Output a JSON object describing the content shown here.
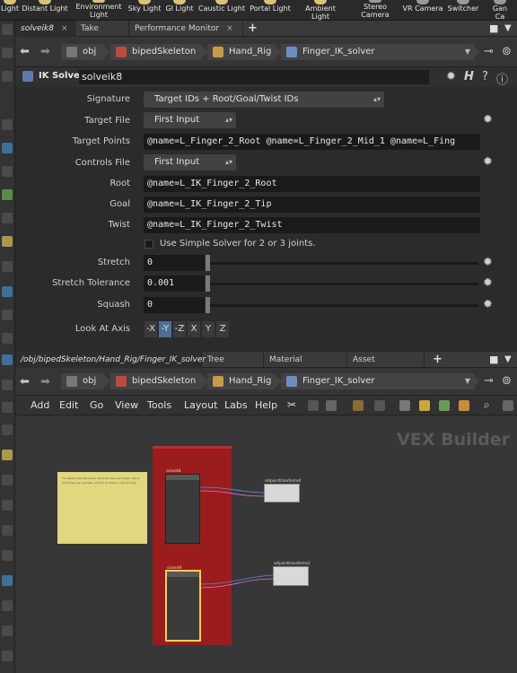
{
  "shelf_tools": [
    "Light",
    "Distant Light",
    "Environment Light",
    "Sky Light",
    "GI Light",
    "Caustic Light",
    "Portal Light",
    "Ambient Light",
    "Stereo Camera",
    "VR Camera",
    "Switcher",
    "Gan Ca"
  ],
  "top_tabs": {
    "active": "solveik8",
    "others": [
      "Take List",
      "Performance Monitor"
    ]
  },
  "path_top": {
    "back": "←",
    "forward": "→",
    "segments": [
      "obj",
      "bipedSkeleton",
      "Hand_Rig",
      "Finger_IK_solver"
    ]
  },
  "param_header": {
    "type_label": "IK Solver",
    "node_name": "solveik8"
  },
  "params": {
    "signature": {
      "label": "Signature",
      "value": "Target IDs + Root/Goal/Twist IDs"
    },
    "target_file": {
      "label": "Target File",
      "value": "First Input"
    },
    "target_points": {
      "label": "Target Points",
      "value": "@name=L_Finger_2_Root @name=L_Finger_2_Mid_1 @name=L_Fing"
    },
    "controls_file": {
      "label": "Controls File",
      "value": "First Input"
    },
    "root": {
      "label": "Root",
      "value": "@name=L_IK_Finger_2_Root"
    },
    "goal": {
      "label": "Goal",
      "value": "@name=L_IK_Finger_2_Tip"
    },
    "twist": {
      "label": "Twist",
      "value": "@name=L_IK_Finger_2_Twist"
    },
    "simple_solver": {
      "label": "Use Simple Solver for 2 or 3 joints.",
      "checked": false
    },
    "stretch": {
      "label": "Stretch",
      "value": "0"
    },
    "stretch_tolerance": {
      "label": "Stretch Tolerance",
      "value": "0.001"
    },
    "squash": {
      "label": "Squash",
      "value": "0"
    },
    "look_at_axis": {
      "label": "Look At Axis",
      "options": [
        "-X",
        "-Y",
        "-Z",
        "X",
        "Y",
        "Z"
      ],
      "selected": "-Y"
    }
  },
  "bottom_tabs": {
    "active": "/obj/bipedSkeleton/Hand_Rig/Finger_IK_solver",
    "others": [
      "Tree View",
      "Material Palette",
      "Asset Browser"
    ]
  },
  "path_bottom": {
    "segments": [
      "obj",
      "bipedSkeleton",
      "Hand_Rig",
      "Finger_IK_solver"
    ]
  },
  "menus": [
    "Add",
    "Edit",
    "Go",
    "View",
    "Tools",
    "Layout",
    "Labs",
    "Help"
  ],
  "network": {
    "watermark": "VEX Builder",
    "sticky_note": "I'm Aware that this solver input be done per finger, this is how finger as example, but the ik solver is not working",
    "nodes": [
      {
        "name": "solveik8"
      },
      {
        "name": "solveik9"
      },
      {
        "name": "setpointtransforms4"
      },
      {
        "name": "setpointtransforms2"
      }
    ]
  }
}
